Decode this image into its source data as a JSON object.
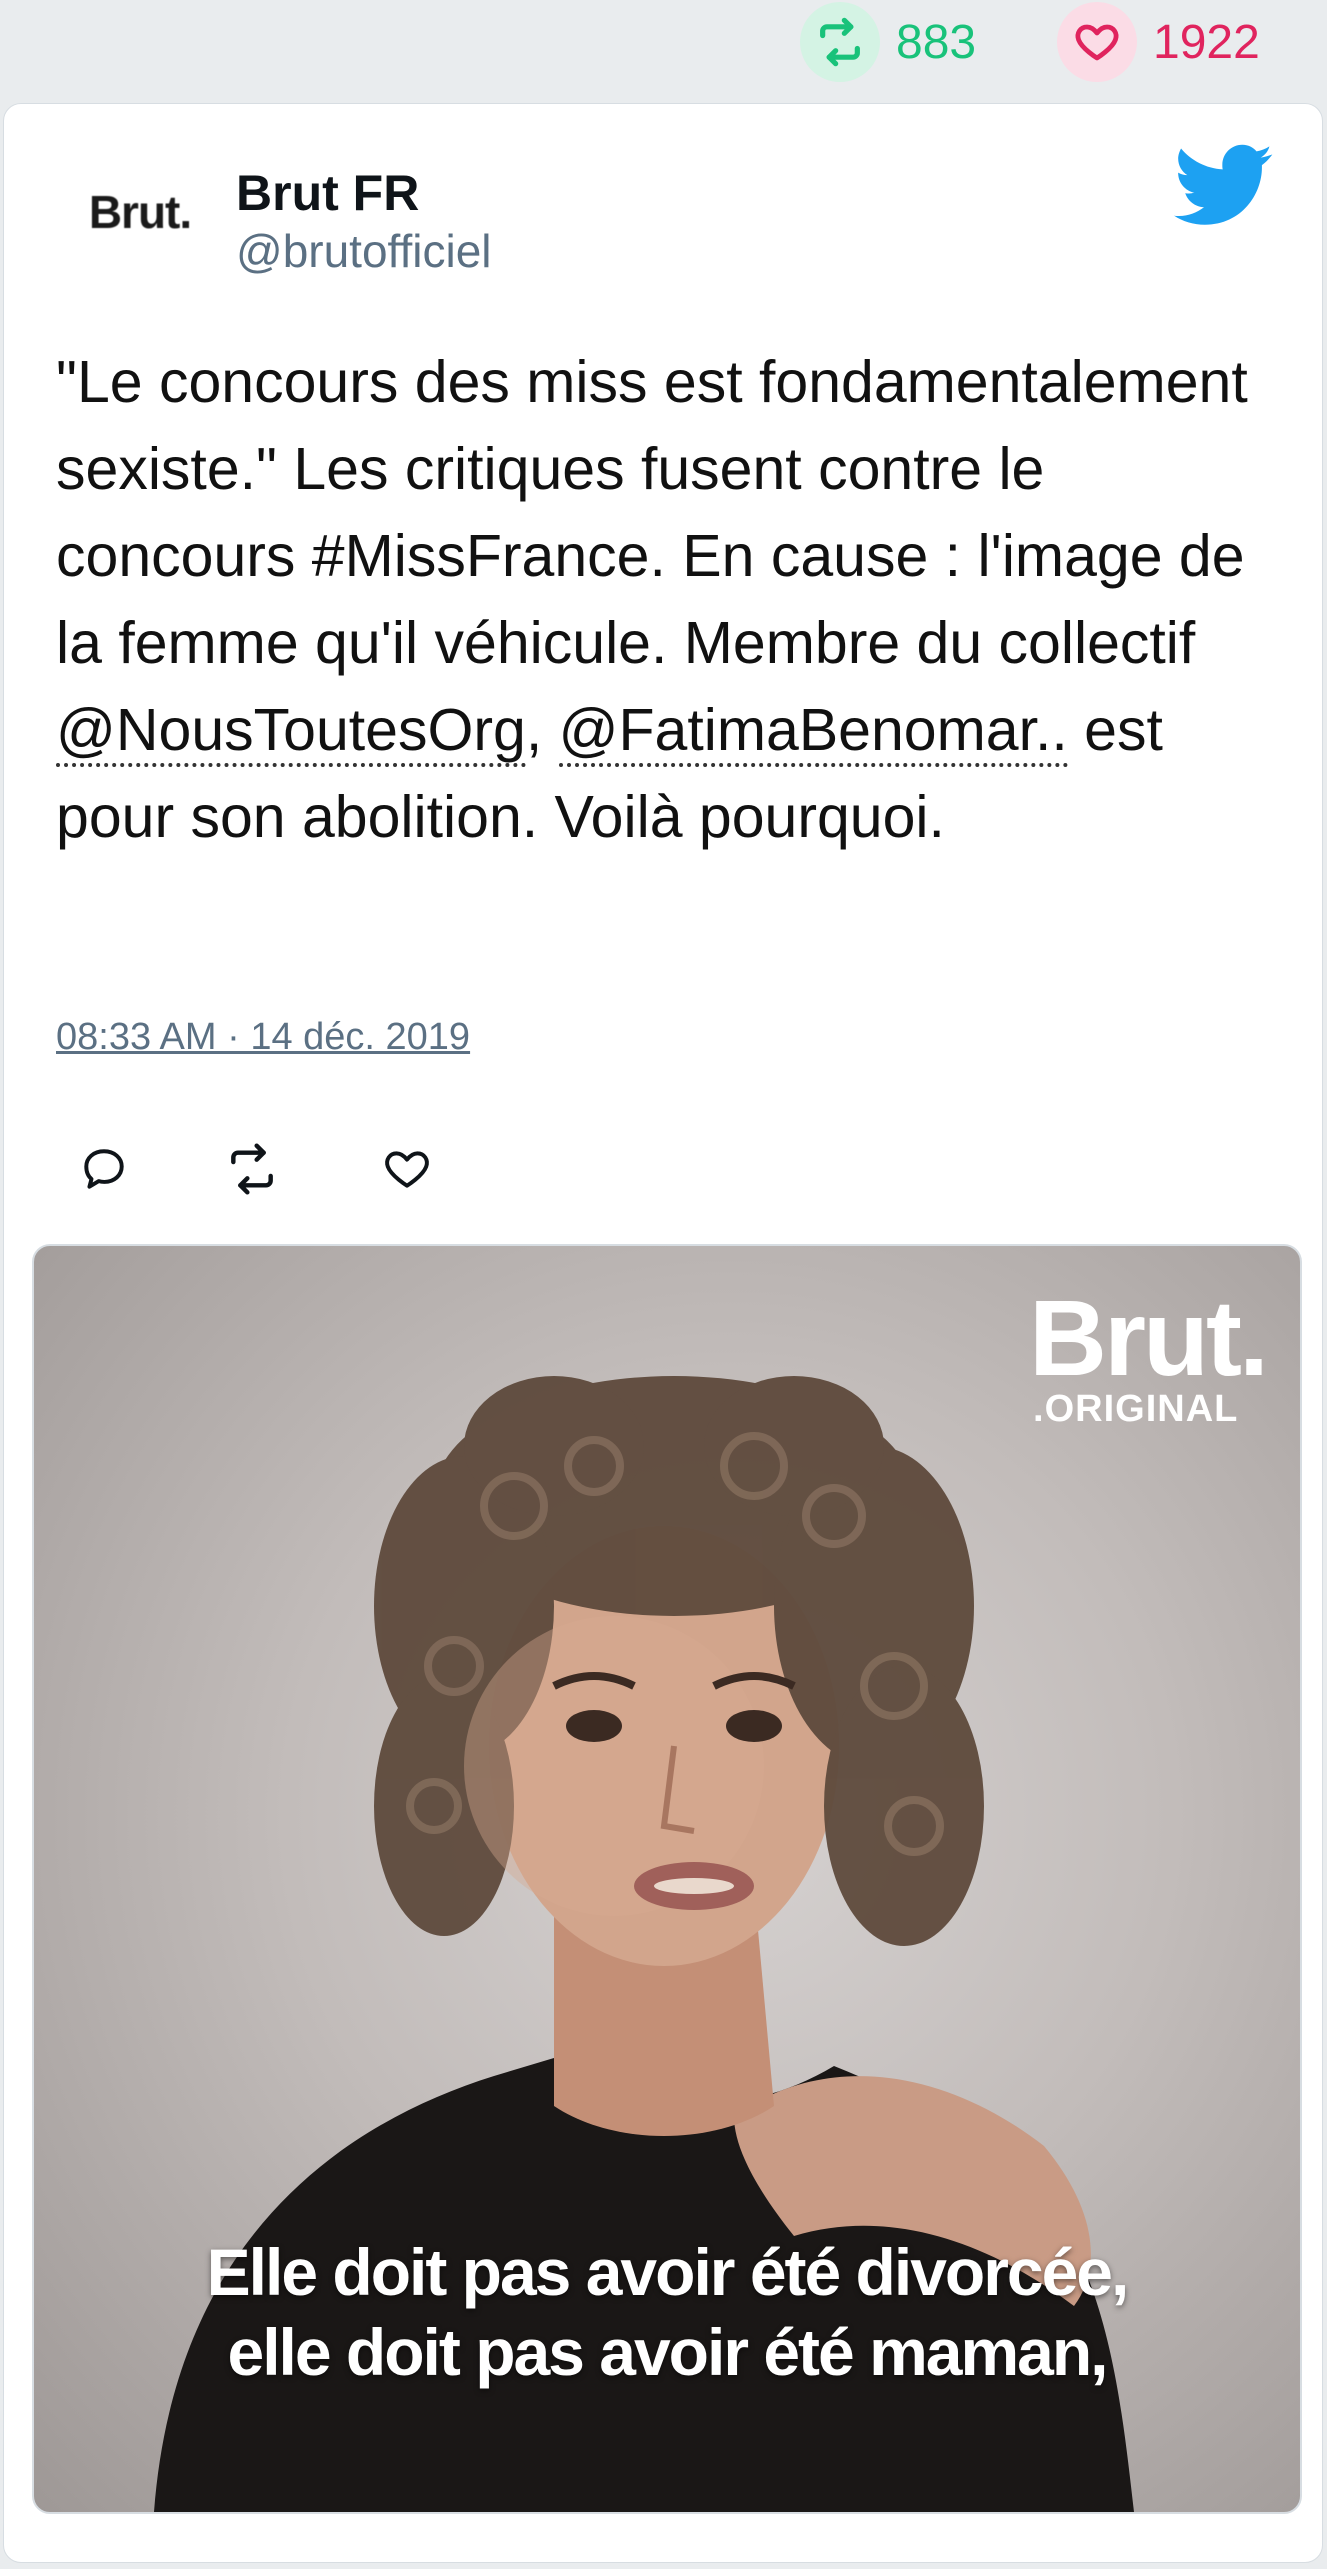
{
  "stats": {
    "retweet_count": "883",
    "like_count": "1922"
  },
  "author": {
    "avatar_text": "Brut.",
    "name": "Brut FR",
    "handle": "@brutofficiel"
  },
  "tweet": {
    "text_part1": "\"Le concours des miss est fondamentalement sexiste.\" Les critiques fusent contre le concours #MissFrance. En cause : l'image de la femme qu'il véhicule. Membre du collectif ",
    "mention1": "@NousToutesOrg",
    "text_part2": ", ",
    "mention2": "@FatimaBenomar",
    "mention2_suffix": "..",
    "text_part3": " est pour son abolition. Voilà pourquoi.",
    "timestamp": "08:33 AM · 14 déc. 2019"
  },
  "media": {
    "brand_main": "Brut.",
    "brand_sub": ".ORIGINAL",
    "caption_line1": "Elle doit pas avoir été divorcée,",
    "caption_line2": "elle doit pas avoir été maman,"
  },
  "colors": {
    "retweet": "#19c27a",
    "like": "#e0245e",
    "twitter_blue": "#1da1f2",
    "secondary_text": "#5b7083"
  },
  "icons": {
    "retweet": "retweet-icon",
    "like": "heart-icon",
    "reply": "reply-icon",
    "brand": "twitter-bird-icon"
  }
}
